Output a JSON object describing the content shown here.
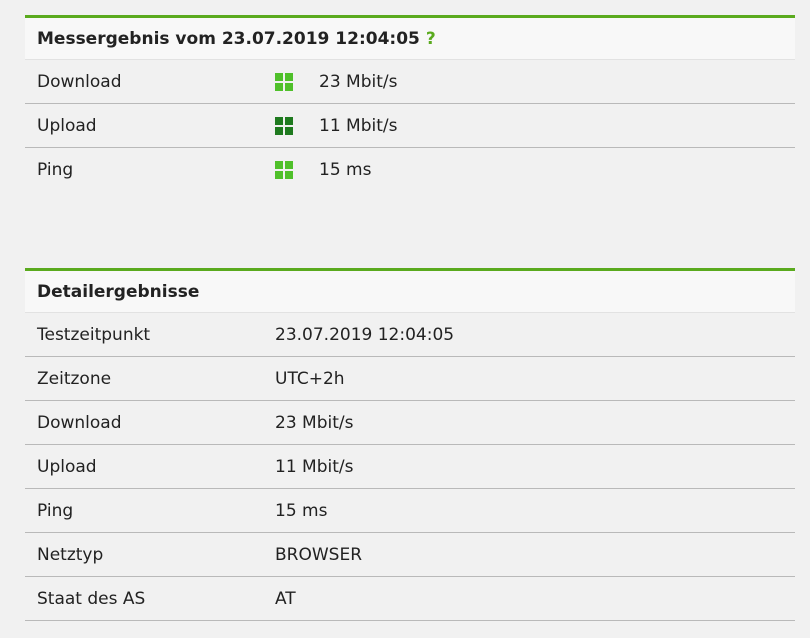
{
  "summary": {
    "title": "Messergebnis vom 23.07.2019 12:04:05",
    "help": "?",
    "rows": [
      {
        "label": "Download",
        "value": "23 Mbit/s",
        "rating": "good"
      },
      {
        "label": "Upload",
        "value": "11 Mbit/s",
        "rating": "excellent"
      },
      {
        "label": "Ping",
        "value": "15 ms",
        "rating": "good"
      }
    ]
  },
  "details": {
    "title": "Detailergebnisse",
    "rows": [
      {
        "label": "Testzeitpunkt",
        "value": "23.07.2019 12:04:05"
      },
      {
        "label": "Zeitzone",
        "value": "UTC+2h"
      },
      {
        "label": "Download",
        "value": "23 Mbit/s"
      },
      {
        "label": "Upload",
        "value": "11 Mbit/s"
      },
      {
        "label": "Ping",
        "value": "15 ms"
      },
      {
        "label": "Netztyp",
        "value": "BROWSER"
      },
      {
        "label": "Staat des AS",
        "value": "AT"
      }
    ]
  },
  "colors": {
    "accent": "#5aaa1e",
    "rating_good": "#4fc02a",
    "rating_excellent": "#1f7a1f"
  },
  "icons": {
    "rating": "rating-squares-icon",
    "help": "help-icon"
  }
}
